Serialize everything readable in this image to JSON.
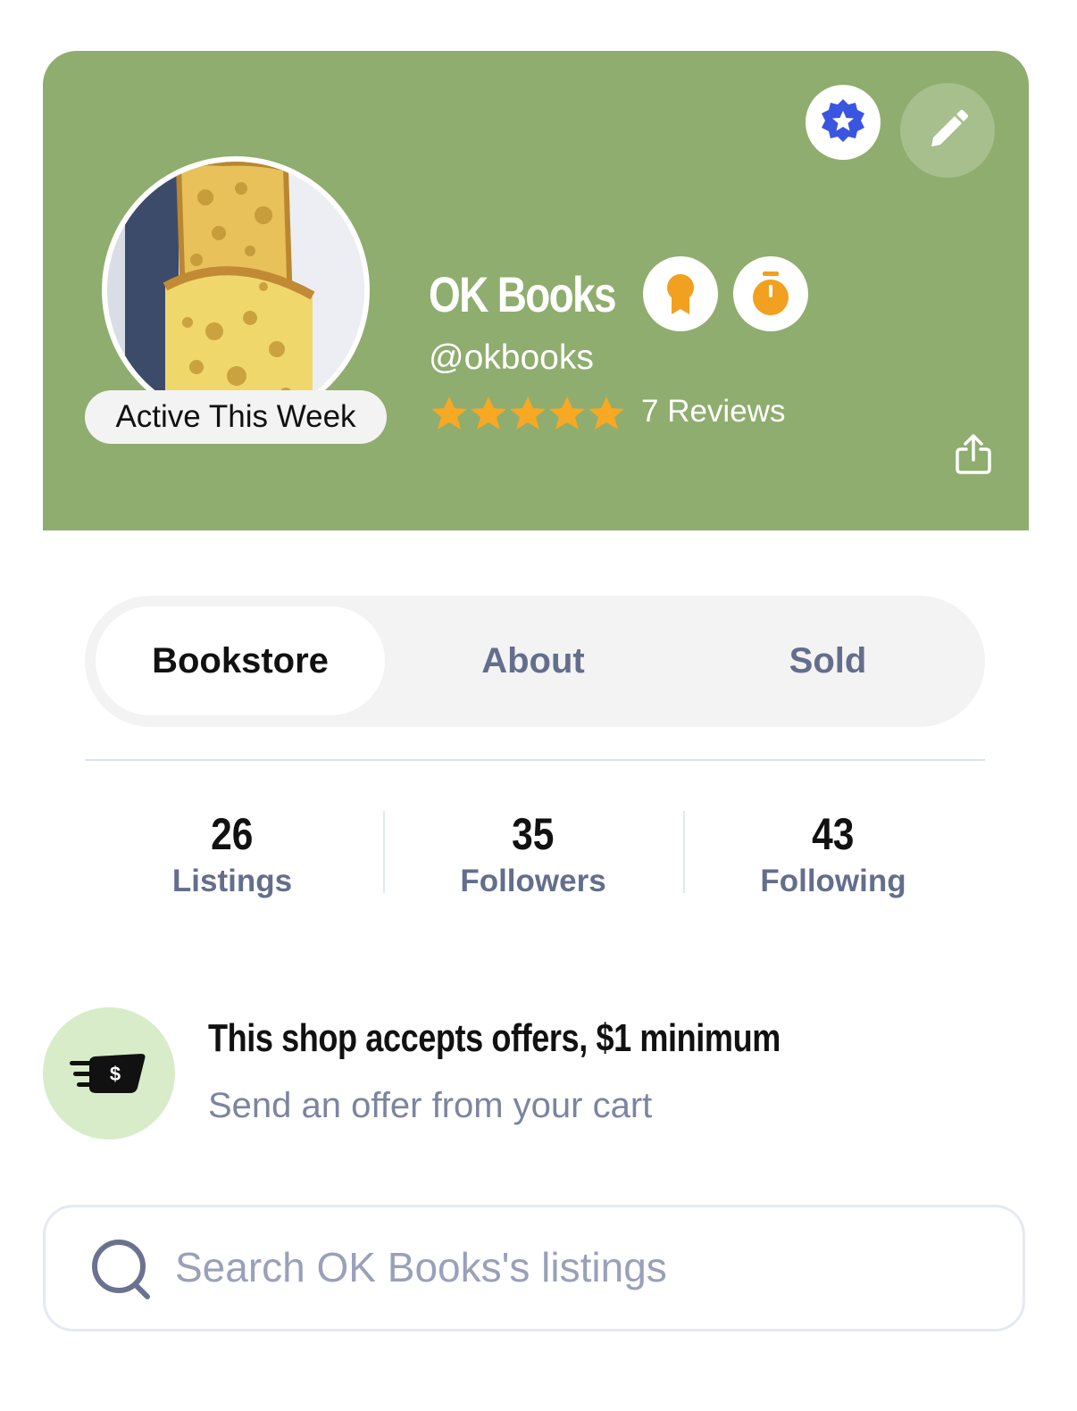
{
  "header": {
    "background_color": "#8fad6e",
    "shop_name": "OK Books",
    "handle": "@okbooks",
    "active_badge": "Active This Week",
    "rating": 5,
    "reviews_label": "7 Reviews",
    "top_icons": [
      "verified-star-badge-icon",
      "edit-pencil-icon"
    ],
    "name_badges": [
      "award-ribbon-icon",
      "stopwatch-icon"
    ],
    "share_icon": "share-icon"
  },
  "tabs": {
    "items": [
      {
        "label": "Bookstore",
        "active": true
      },
      {
        "label": "About",
        "active": false
      },
      {
        "label": "Sold",
        "active": false
      }
    ]
  },
  "stats": [
    {
      "value": "26",
      "label": "Listings"
    },
    {
      "value": "35",
      "label": "Followers"
    },
    {
      "value": "43",
      "label": "Following"
    }
  ],
  "offer": {
    "title": "This shop accepts offers, $1 minimum",
    "subtitle": "Send an offer from your cart",
    "icon": "cash-offer-icon",
    "icon_glyph": "$"
  },
  "search": {
    "placeholder": "Search OK Books's listings"
  }
}
